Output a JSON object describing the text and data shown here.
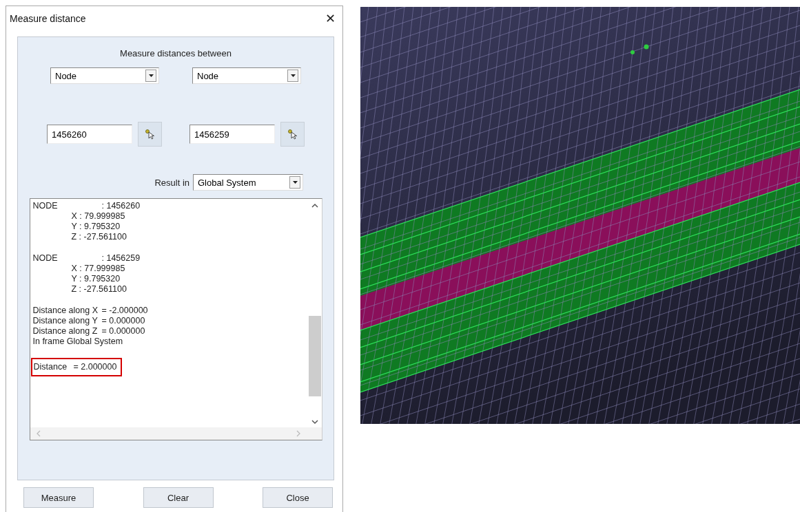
{
  "window": {
    "title": "Measure distance",
    "close": "✕"
  },
  "heading": "Measure distances between",
  "entity_types": [
    {
      "value": "Node"
    },
    {
      "value": "Node"
    }
  ],
  "node_ids": [
    {
      "value": "1456260"
    },
    {
      "value": "1456259"
    }
  ],
  "result_in": {
    "label": "Result in",
    "value": "Global System"
  },
  "output": {
    "blocks": [
      {
        "highlighted": false,
        "lines": [
          {
            "kind": "pair",
            "label": "NODE",
            "value": ": 1456260"
          },
          {
            "kind": "indent",
            "text": "X : 79.999985"
          },
          {
            "kind": "indent",
            "text": "Y : 9.795320"
          },
          {
            "kind": "indent",
            "text": "Z : -27.561100"
          }
        ]
      },
      {
        "highlighted": false,
        "lines": [
          {
            "kind": "pair",
            "label": "NODE",
            "value": ": 1456259"
          },
          {
            "kind": "indent",
            "text": "X : 77.999985"
          },
          {
            "kind": "indent",
            "text": "Y : 9.795320"
          },
          {
            "kind": "indent",
            "text": "Z : -27.561100"
          }
        ]
      },
      {
        "highlighted": false,
        "lines": [
          {
            "kind": "pair",
            "label": "Distance along X",
            "value": "= -2.000000"
          },
          {
            "kind": "pair",
            "label": "Distance along Y",
            "value": "= 0.000000"
          },
          {
            "kind": "pair",
            "label": "Distance along Z",
            "value": "= 0.000000"
          },
          {
            "kind": "plain",
            "text": "In frame Global System"
          }
        ]
      },
      {
        "highlighted": true,
        "lines": [
          {
            "kind": "short",
            "label": "Distance",
            "value": "= 2.000000"
          }
        ]
      }
    ]
  },
  "buttons": [
    {
      "label": "Measure"
    },
    {
      "label": "Clear"
    },
    {
      "label": "Close"
    }
  ]
}
